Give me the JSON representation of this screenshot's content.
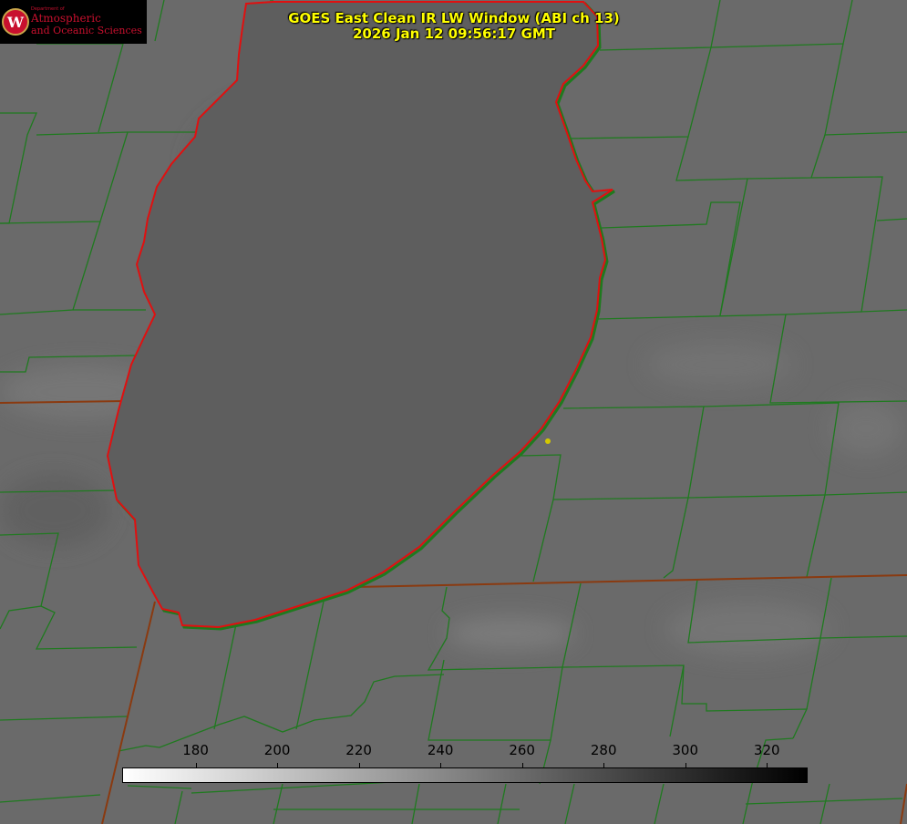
{
  "title": {
    "line1": "GOES East Clean IR LW Window (ABI ch 13)",
    "line2": "2026 Jan 12 09:56:17 GMT"
  },
  "logo": {
    "department": "Department of",
    "line1": "Atmospheric",
    "line2": "and Oceanic Sciences",
    "seal_letter": "W"
  },
  "colorbar": {
    "min": 162,
    "max": 330,
    "ticks": [
      180,
      200,
      220,
      240,
      260,
      280,
      300,
      320
    ],
    "gradient_from": "#ffffff",
    "gradient_to": "#000000"
  },
  "colors": {
    "lake_outline": "#e01010",
    "boundaries": "#1f7a1f",
    "land": "#6a6a6a",
    "lake": "#5e5e5e",
    "title_text": "#ffff00"
  }
}
